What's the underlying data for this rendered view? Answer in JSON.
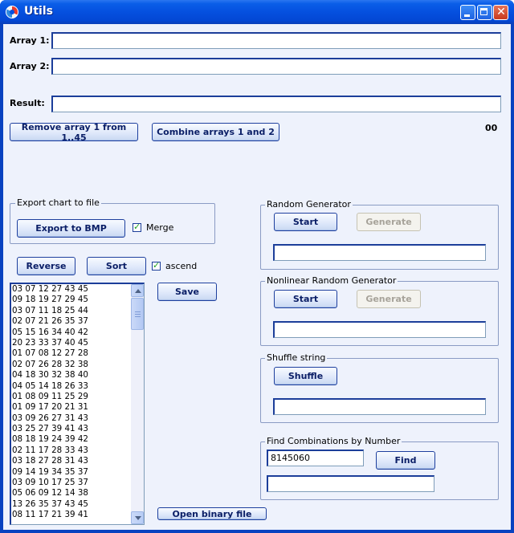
{
  "window": {
    "title": "Utils"
  },
  "fields": {
    "array1_label": "Array 1:",
    "array1_value": "",
    "array2_label": "Array 2:",
    "array2_value": "",
    "result_label": "Result:",
    "result_value": ""
  },
  "actions": {
    "remove_array_label": "Remove array 1 from 1..45",
    "combine_arrays_label": "Combine arrays 1 and 2",
    "counter_text": "00"
  },
  "export_group": {
    "title": "Export chart to file",
    "export_button": "Export to BMP",
    "merge_label": "Merge",
    "merge_checked": true
  },
  "list_controls": {
    "reverse_label": "Reverse",
    "sort_label": "Sort",
    "ascend_label": "ascend",
    "ascend_checked": true,
    "save_label": "Save",
    "open_binary_label": "Open binary file"
  },
  "list_items": [
    "03 07 12 27 43 45",
    "09 18 19 27 29 45",
    "03 07 11 18 25 44",
    "02 07 21 26 35 37",
    "05 15 16 34 40 42",
    "20 23 33 37 40 45",
    "01 07 08 12 27 28",
    "02 07 26 28 32 38",
    "04 18 30 32 38 40",
    "04 05 14 18 26 33",
    "01 08 09 11 25 29",
    "01 09 17 20 21 31",
    "03 09 26 27 31 43",
    "03 25 27 39 41 43",
    "08 18 19 24 39 42",
    "02 11 17 28 33 43",
    "03 18 27 28 31 43",
    "09 14 19 34 35 37",
    "03 09 10 17 25 37",
    "05 06 09 12 14 38",
    "13 26 35 37 43 45",
    "08 11 17 21 39 41"
  ],
  "random_group": {
    "title": "Random Generator",
    "start_label": "Start",
    "generate_label": "Generate",
    "output_value": ""
  },
  "nonlinear_group": {
    "title": "Nonlinear Random Generator",
    "start_label": "Start",
    "generate_label": "Generate",
    "output_value": ""
  },
  "shuffle_group": {
    "title": "Shuffle string",
    "shuffle_label": "Shuffle",
    "output_value": ""
  },
  "find_group": {
    "title": "Find Combinations by Number",
    "number_value": "8145060",
    "find_label": "Find",
    "output_value": ""
  },
  "colors": {
    "title_bar": "#0550df",
    "client_bg": "#eef2fc",
    "button_text": "#0a1e66"
  }
}
